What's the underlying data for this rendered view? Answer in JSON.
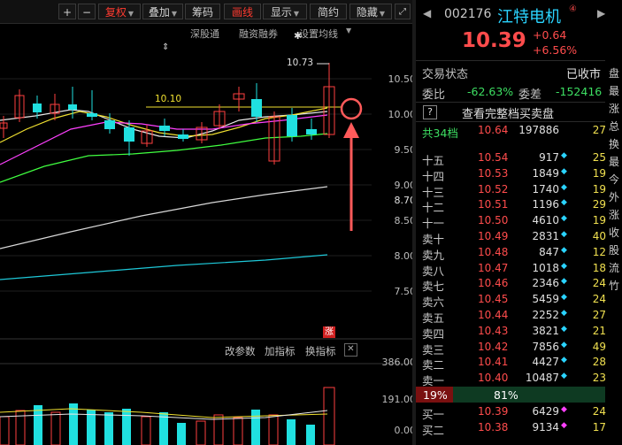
{
  "toolbar": {
    "plus": "+",
    "minus": "−",
    "fuquan": "复权",
    "diejia": "叠加",
    "chouma": "筹码",
    "huaxian": "画线",
    "xianshi": "显示",
    "jianyue": "简约",
    "yincang": "隐藏"
  },
  "chart_links": {
    "shenguotong": "深股通",
    "rongzi": "融资融券",
    "setma": "设置均线"
  },
  "price_axis": [
    "10.50",
    "10.00",
    "9.50",
    "9.00",
    "8.70",
    "8.50",
    "8.00",
    "7.50"
  ],
  "annotations": {
    "high": "10.73",
    "line": "10.10",
    "zhang": "涨"
  },
  "vol_toolbar": {
    "param": "改参数",
    "add": "加指标",
    "switch": "换指标",
    "close": "✕"
  },
  "vol_axis": [
    "386.00",
    "191.00",
    "0.00"
  ],
  "stock": {
    "code": "002176",
    "name": "江特电机",
    "badge": "④",
    "price": "10.39",
    "change": "+0.64",
    "pct": "+6.56%"
  },
  "trade": {
    "status_label": "交易状态",
    "status": "已收市",
    "weibi_label": "委比",
    "weibi": "-62.63%",
    "weicha_label": "委差",
    "weicha": "-152416"
  },
  "fullbook": {
    "q": "?",
    "label": "查看完整档买卖盘"
  },
  "total_row": {
    "label": "共34档",
    "price": "10.64",
    "vol": "197886",
    "count": "27"
  },
  "asks": [
    {
      "level": "十五",
      "price": "10.54",
      "vol": "917",
      "count": "25"
    },
    {
      "level": "十四",
      "price": "10.53",
      "vol": "1849",
      "count": "19"
    },
    {
      "level": "十三",
      "price": "10.52",
      "vol": "1740",
      "count": "19"
    },
    {
      "level": "十二",
      "price": "10.51",
      "vol": "1196",
      "count": "29"
    },
    {
      "level": "十一",
      "price": "10.50",
      "vol": "4610",
      "count": "19"
    },
    {
      "level": "卖十",
      "price": "10.49",
      "vol": "2831",
      "count": "40"
    },
    {
      "level": "卖九",
      "price": "10.48",
      "vol": "847",
      "count": "12"
    },
    {
      "level": "卖八",
      "price": "10.47",
      "vol": "1018",
      "count": "18"
    },
    {
      "level": "卖七",
      "price": "10.46",
      "vol": "2346",
      "count": "24"
    },
    {
      "level": "卖六",
      "price": "10.45",
      "vol": "5459",
      "count": "24"
    },
    {
      "level": "卖五",
      "price": "10.44",
      "vol": "2252",
      "count": "27"
    },
    {
      "level": "卖四",
      "price": "10.43",
      "vol": "3821",
      "count": "21"
    },
    {
      "level": "卖三",
      "price": "10.42",
      "vol": "7856",
      "count": "49"
    },
    {
      "level": "卖二",
      "price": "10.41",
      "vol": "4427",
      "count": "28"
    },
    {
      "level": "卖一",
      "price": "10.40",
      "vol": "10487",
      "count": "23"
    }
  ],
  "ratio": {
    "left": "19%",
    "right": "81%"
  },
  "bids": [
    {
      "level": "买一",
      "price": "10.39",
      "vol": "6429",
      "count": "24"
    },
    {
      "level": "买二",
      "price": "10.38",
      "vol": "9134",
      "count": "17"
    }
  ],
  "side_chars": [
    "盘",
    "最",
    "涨",
    "总",
    "换",
    "最",
    "今",
    "外",
    "涨",
    "收",
    "股",
    "流",
    "竹"
  ]
}
